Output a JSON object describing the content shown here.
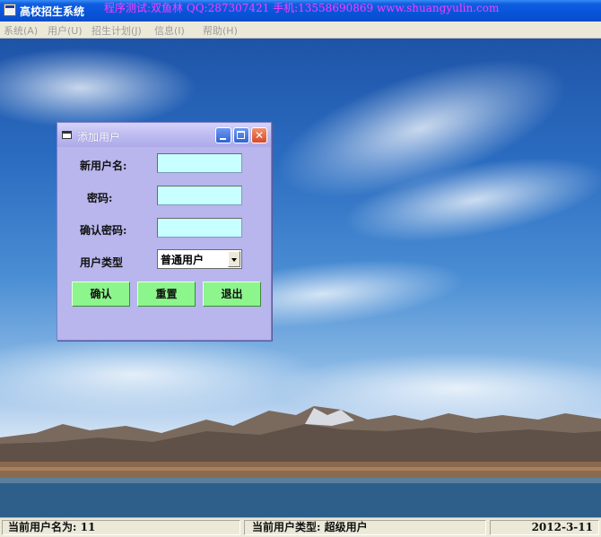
{
  "window": {
    "title": "高校招生系统",
    "banner": "程序测试:双鱼林 QQ:287307421 手机:13558690869 www.shuangyulin.com"
  },
  "menu": [
    "系统(A)",
    "用户(U)",
    "招生计划(J)",
    "信息(I)",
    "帮助(H)"
  ],
  "dialog": {
    "title": "添加用户",
    "labels": {
      "username": "新用户名:",
      "password": "密码:",
      "confirm": "确认密码:",
      "type": "用户类型"
    },
    "values": {
      "username": "",
      "password": "",
      "confirm": ""
    },
    "user_type_selected": "普通用户",
    "buttons": {
      "ok": "确认",
      "reset": "重置",
      "exit": "退出"
    },
    "colors": {
      "background": "#b8b6ec",
      "input": "#c8ffff",
      "button": "#8cf58c"
    }
  },
  "status": {
    "current_user": "当前用户名为: 11",
    "user_type": "当前用户类型: 超级用户",
    "date": "2012-3-11"
  },
  "colors": {
    "titlebar": "#0753d9",
    "banner_text": "#ff3cff"
  }
}
